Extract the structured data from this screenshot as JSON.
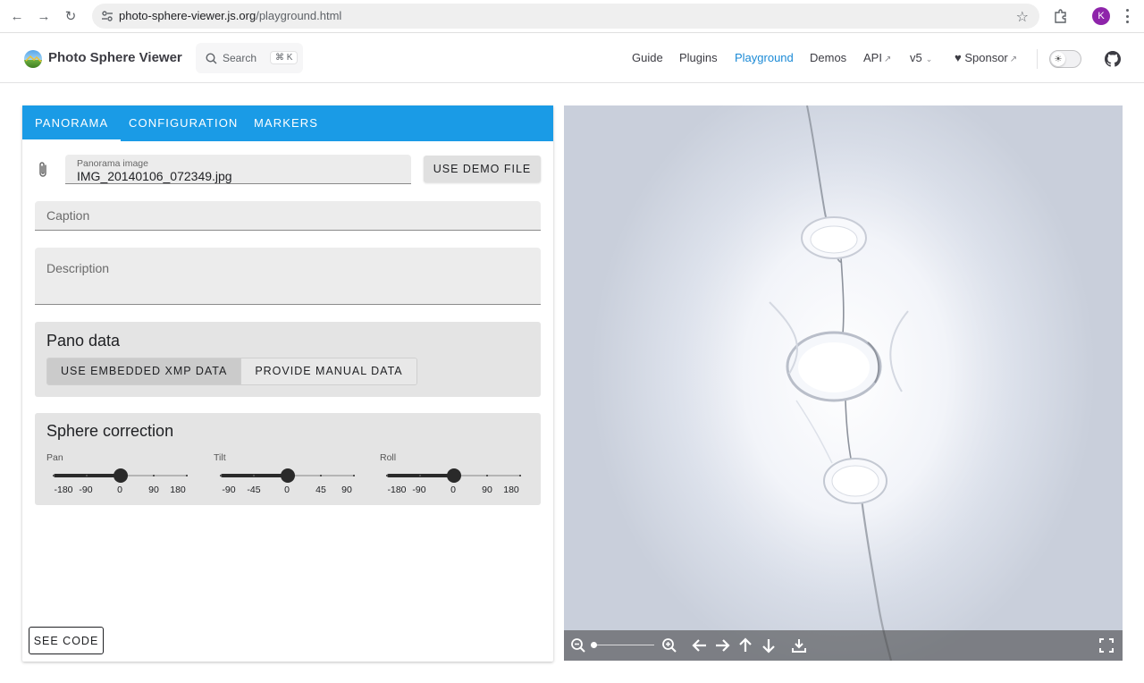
{
  "browser": {
    "url_host": "photo-sphere-viewer.js.org",
    "url_path": "/playground.html",
    "profile_initial": "K"
  },
  "header": {
    "site_title": "Photo Sphere Viewer",
    "search_label": "Search",
    "search_shortcut": "⌘ K",
    "nav": {
      "guide": "Guide",
      "plugins": "Plugins",
      "playground": "Playground",
      "demos": "Demos",
      "api": "API",
      "version": "v5",
      "sponsor": "Sponsor"
    },
    "accent_color": "#1b8ad6"
  },
  "panel": {
    "tabs": [
      "PANORAMA",
      "CONFIGURATION",
      "MARKERS"
    ],
    "active_tab": "PANORAMA",
    "tab_bar_color": "#1a9be6",
    "panorama_field": {
      "label": "Panorama image",
      "value": "IMG_20140106_072349.jpg"
    },
    "demo_button": "USE DEMO FILE",
    "caption_placeholder": "Caption",
    "description_placeholder": "Description",
    "pano_data": {
      "title": "Pano data",
      "options": [
        "USE EMBEDDED XMP DATA",
        "PROVIDE MANUAL DATA"
      ],
      "selected": "USE EMBEDDED XMP DATA"
    },
    "sphere_correction": {
      "title": "Sphere correction",
      "sliders": [
        {
          "label": "Pan",
          "min": -180,
          "max": 180,
          "value": 0,
          "ticks": [
            "-180",
            "-90",
            "0",
            "90",
            "180"
          ]
        },
        {
          "label": "Tilt",
          "min": -90,
          "max": 90,
          "value": 0,
          "ticks": [
            "-90",
            "-45",
            "0",
            "45",
            "90"
          ]
        },
        {
          "label": "Roll",
          "min": -180,
          "max": 180,
          "value": 0,
          "ticks": [
            "-180",
            "-90",
            "0",
            "90",
            "180"
          ]
        }
      ]
    },
    "see_code_button": "SEE CODE"
  },
  "viewer": {
    "navbar_icons": [
      "zoom-out-icon",
      "zoom-in-icon",
      "arrow-left-icon",
      "arrow-right-icon",
      "arrow-up-icon",
      "arrow-down-icon",
      "download-icon",
      "fullscreen-icon"
    ],
    "zoom_level": 0
  }
}
